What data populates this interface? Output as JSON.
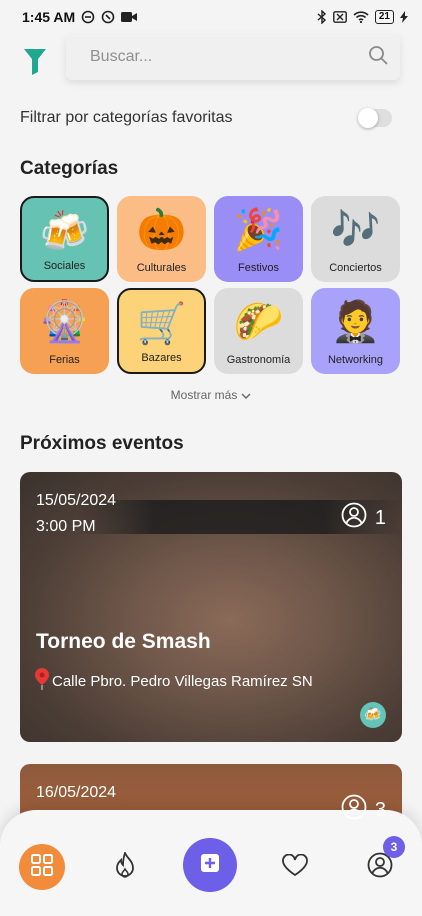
{
  "status_bar": {
    "time": "1:45 AM",
    "battery": "21"
  },
  "search": {
    "placeholder": "Buscar..."
  },
  "filter": {
    "label": "Filtrar por categorías favoritas",
    "enabled": false
  },
  "categories_section": {
    "title": "Categorías",
    "items": [
      {
        "label": "Sociales",
        "emoji": "🍻",
        "color": "#66c2b2",
        "selected": true
      },
      {
        "label": "Culturales",
        "emoji": "🎃",
        "color": "#fcbc86",
        "selected": false
      },
      {
        "label": "Festivos",
        "emoji": "🎉",
        "color": "#9a8df6",
        "selected": false
      },
      {
        "label": "Conciertos",
        "emoji": "🎶",
        "color": "#dcdcdc",
        "selected": false
      },
      {
        "label": "Ferias",
        "emoji": "🎡",
        "color": "#f6a054",
        "selected": false
      },
      {
        "label": "Bazares",
        "emoji": "🛒",
        "color": "#fdd37a",
        "selected": true
      },
      {
        "label": "Gastronomía",
        "emoji": "🌮",
        "color": "#dcdcdc",
        "selected": false
      },
      {
        "label": "Networking",
        "emoji": "🤵",
        "color": "#a8a2fb",
        "selected": false
      }
    ],
    "show_more": "Mostrar más"
  },
  "events_section": {
    "title": "Próximos eventos",
    "events": [
      {
        "date": "15/05/2024",
        "time": "3:00 PM",
        "attendees": "1",
        "name": "Torneo de Smash",
        "location": "Calle Pbro. Pedro Villegas Ramírez SN",
        "category_emoji": "🍻"
      },
      {
        "date": "16/05/2024",
        "attendees": "3"
      }
    ]
  },
  "bottom_nav": {
    "notification_count": "3"
  },
  "colors": {
    "accent": "#6d5fe8",
    "home": "#f28b3a",
    "filter_icon": "#1fa88f"
  }
}
